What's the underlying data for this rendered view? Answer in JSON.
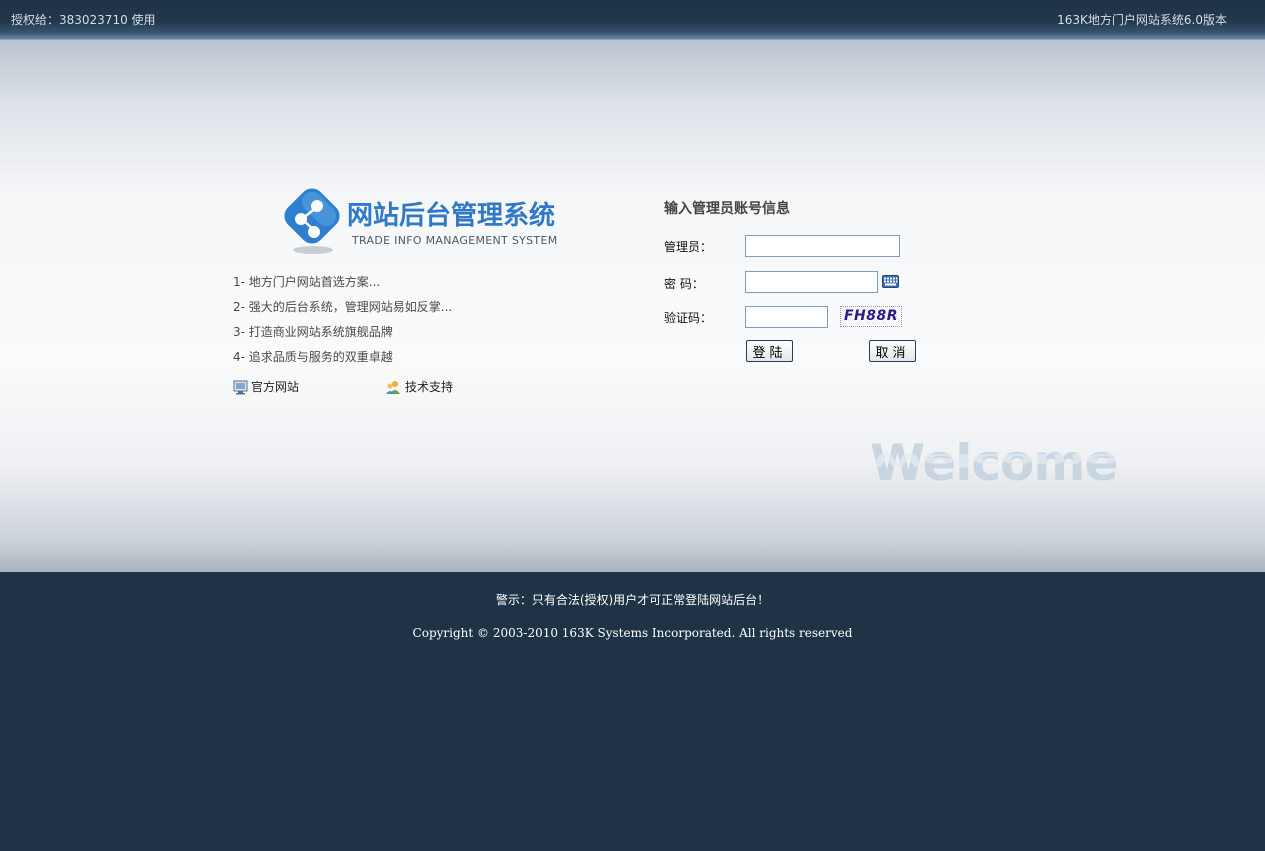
{
  "topbar": {
    "license": "授权给：383023710 使用",
    "version": "163K地方门户网站系统6.0版本"
  },
  "logo": {
    "title": "网站后台管理系统",
    "subtitle": "TRADE INFO MANAGEMENT SYSTEM",
    "icon": "share-network-icon",
    "brand_color": "#2f79c8"
  },
  "features": [
    "1- 地方门户网站首选方案...",
    "2- 强大的后台系统，管理网站易如反掌...",
    "3- 打造商业网站系统旗舰品牌",
    "4- 追求品质与服务的双重卓越"
  ],
  "links": {
    "official": {
      "label": "官方网站",
      "icon": "monitor-icon"
    },
    "support": {
      "label": "技术支持",
      "icon": "users-icon"
    }
  },
  "login": {
    "title": "输入管理员账号信息",
    "admin_label": "管理员：",
    "admin_value": "",
    "password_label": "密  码：",
    "password_value": "",
    "keyboard_icon": "keyboard-icon",
    "captcha_label": "验证码：",
    "captcha_value": "",
    "captcha_image_text": "FH88R",
    "submit_label": "登陆",
    "cancel_label": "取消"
  },
  "welcome_text": "Welcome",
  "footer": {
    "warning": "警示：只有合法(授权)用户才可正常登陆网站后台！",
    "copyright": "Copyright © 2003-2010 163K Systems Incorporated. All rights reserved"
  },
  "colors": {
    "header_bg": "#1f3347",
    "footer_bg": "#1f3347",
    "input_border": "#7f9db9"
  }
}
